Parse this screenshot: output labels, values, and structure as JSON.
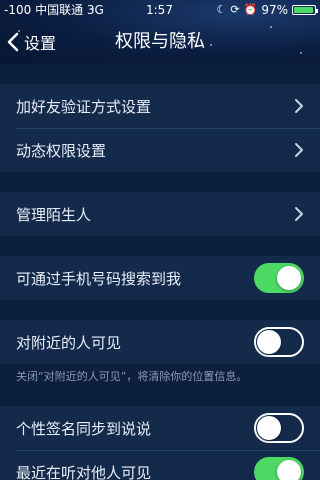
{
  "status_bar": {
    "signal": "-100",
    "carrier": "中国联通",
    "network": "3G",
    "time": "1:57",
    "battery_percent": "97%",
    "battery_level": 0.97
  },
  "nav": {
    "back_label": "设置",
    "title": "权限与隐私"
  },
  "groups": {
    "g1": {
      "items": [
        "加好友验证方式设置",
        "动态权限设置"
      ]
    },
    "g2": {
      "items": [
        "管理陌生人"
      ]
    },
    "g3": {
      "label": "可通过手机号码搜索到我",
      "toggle_on": true
    },
    "g4": {
      "label": "对附近的人可见",
      "toggle_on": false,
      "note": "关闭“对附近的人可见”，将清除你的位置信息。"
    },
    "g5": {
      "items": [
        {
          "label": "个性签名同步到说说",
          "toggle_on": false
        },
        {
          "label": "最近在听对他人可见",
          "toggle_on": true
        }
      ]
    }
  },
  "colors": {
    "toggle_on": "#4cd964",
    "background": "#0c1f3c",
    "cell": "#132a4a"
  }
}
